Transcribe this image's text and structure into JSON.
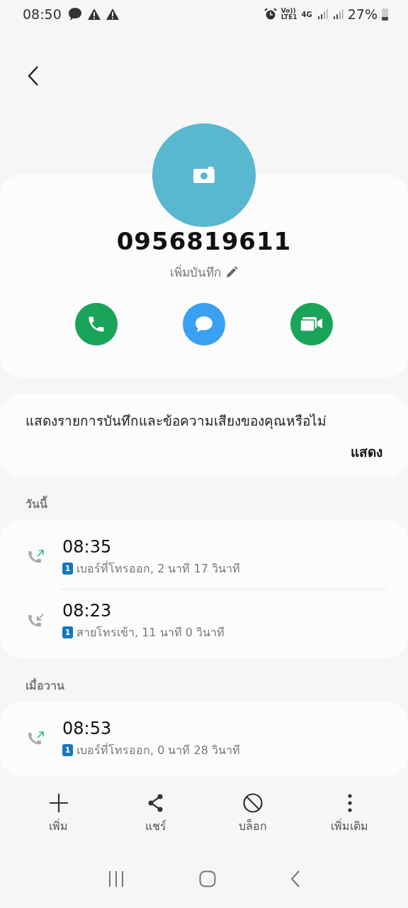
{
  "status_bar": {
    "time": "08:50",
    "volte": "Vo))",
    "lte": "LTE1",
    "network": "4G",
    "battery": "27%"
  },
  "contact": {
    "number": "0956819611",
    "note_prompt": "เพิ่มบันทึก"
  },
  "quick_actions": [
    {
      "kind": "call",
      "color": "#1aa45a"
    },
    {
      "kind": "message",
      "color": "#3aa1f2"
    },
    {
      "kind": "video",
      "color": "#1aa45a"
    }
  ],
  "notice": {
    "text": "แสดงรายการบันทึกและข้อความเสียงของคุณหรือไม่",
    "action": "แสดง"
  },
  "history": [
    {
      "label": "วันนี้",
      "calls": [
        {
          "kind": "outgoing",
          "sim": "1",
          "time": "08:35",
          "detail": "เบอร์ที่โทรออก, 2 นาที 17 วินาที"
        },
        {
          "kind": "incoming",
          "sim": "1",
          "time": "08:23",
          "detail": "สายโทรเข้า, 11 นาที 0 วินาที"
        }
      ]
    },
    {
      "label": "เมื่อวาน",
      "calls": [
        {
          "kind": "outgoing",
          "sim": "1",
          "time": "08:53",
          "detail": "เบอร์ที่โทรออก, 0 นาที 28 วินาที"
        }
      ]
    }
  ],
  "bottom_actions": [
    {
      "kind": "add",
      "label": "เพิ่ม"
    },
    {
      "kind": "share",
      "label": "แชร์"
    },
    {
      "kind": "block",
      "label": "บล็อก"
    },
    {
      "kind": "more",
      "label": "เพิ่มเติม"
    }
  ]
}
